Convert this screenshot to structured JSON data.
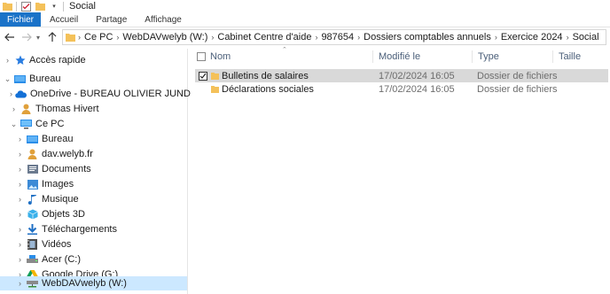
{
  "window": {
    "title": "Social"
  },
  "ribbon": {
    "tabs": [
      "Fichier",
      "Accueil",
      "Partage",
      "Affichage"
    ]
  },
  "address": {
    "crumbs": [
      "Ce PC",
      "WebDAVwelyb (W:)",
      "Cabinet Centre d'aide",
      "987654",
      "Dossiers comptables annuels",
      "Exercice 2024",
      "Social"
    ]
  },
  "nav_tree": {
    "items": [
      {
        "label": "Accès rapide",
        "icon": "star-icon",
        "level": 0,
        "expanded": false,
        "selected": false
      },
      {
        "label": "Bureau",
        "icon": "desktop-icon",
        "level": 0,
        "expanded": true,
        "selected": false
      },
      {
        "label": "OneDrive - BUREAU OLIVIER JUND",
        "icon": "cloud-icon",
        "level": 1,
        "expanded": false,
        "selected": false
      },
      {
        "label": "Thomas Hivert",
        "icon": "user-icon",
        "level": 1,
        "expanded": false,
        "selected": false
      },
      {
        "label": "Ce PC",
        "icon": "computer-icon",
        "level": 1,
        "expanded": true,
        "selected": false
      },
      {
        "label": "Bureau",
        "icon": "desktop-icon",
        "level": 2,
        "expanded": false,
        "selected": false
      },
      {
        "label": "dav.welyb.fr",
        "icon": "user-icon",
        "level": 2,
        "expanded": false,
        "selected": false
      },
      {
        "label": "Documents",
        "icon": "documents-icon",
        "level": 2,
        "expanded": false,
        "selected": false
      },
      {
        "label": "Images",
        "icon": "images-icon",
        "level": 2,
        "expanded": false,
        "selected": false
      },
      {
        "label": "Musique",
        "icon": "music-icon",
        "level": 2,
        "expanded": false,
        "selected": false
      },
      {
        "label": "Objets 3D",
        "icon": "cube-icon",
        "level": 2,
        "expanded": false,
        "selected": false
      },
      {
        "label": "Téléchargements",
        "icon": "download-icon",
        "level": 2,
        "expanded": false,
        "selected": false
      },
      {
        "label": "Vidéos",
        "icon": "video-icon",
        "level": 2,
        "expanded": false,
        "selected": false
      },
      {
        "label": "Acer (C:)",
        "icon": "drive-icon",
        "level": 2,
        "expanded": false,
        "selected": false
      },
      {
        "label": "Google Drive (G:)",
        "icon": "google-drive-icon",
        "level": 2,
        "expanded": false,
        "selected": false
      },
      {
        "label": "WebDAVwelyb (W:)",
        "icon": "network-drive-icon",
        "level": 2,
        "expanded": false,
        "selected": true
      }
    ]
  },
  "file_list": {
    "columns": [
      "Nom",
      "Modifié le",
      "Type",
      "Taille"
    ],
    "rows": [
      {
        "name": "Bulletins de salaires",
        "modified": "17/02/2024 16:05",
        "type": "Dossier de fichiers",
        "size": "",
        "selected": true
      },
      {
        "name": "Déclarations sociales",
        "modified": "17/02/2024 16:05",
        "type": "Dossier de fichiers",
        "size": "",
        "selected": false
      }
    ]
  },
  "colors": {
    "accent": "#1a73c8",
    "selection_nav": "#cce8ff",
    "selection_row": "#d9d9d9",
    "folder": "#f4c15a"
  }
}
